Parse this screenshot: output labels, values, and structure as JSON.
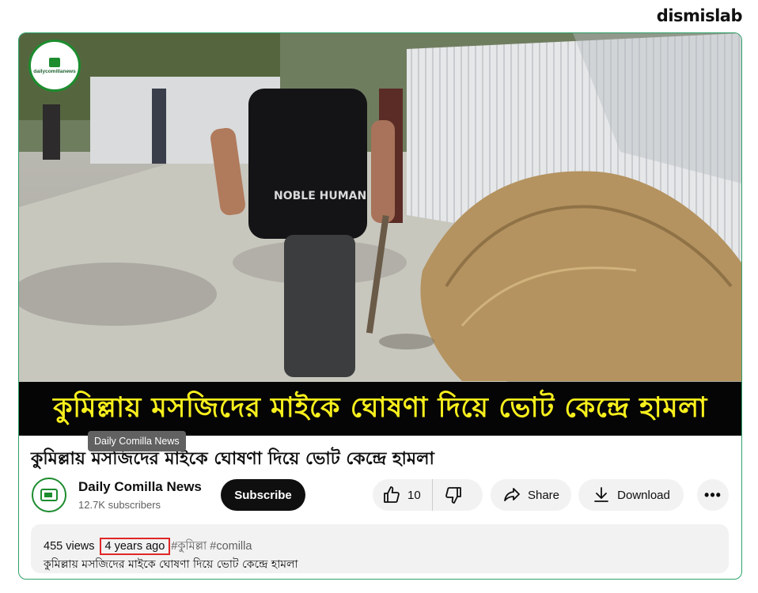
{
  "brand": "dismislab",
  "video": {
    "channel_logo_text": "dailycomillanews",
    "caption": "কুমিল্লায় মসজিদের মাইকে ঘোষণা দিয়ে ভোট কেন্দ্রে হামলা",
    "shirt_text": "NOBLE HUMAN"
  },
  "tooltip": "Daily Comilla News",
  "title": "কুমিল্লায় মসজিদের মাইকে ঘোষণা দিয়ে ভোট কেন্দ্রে হামলা",
  "owner": {
    "name": "Daily Comilla News",
    "subscribers": "12.7K subscribers"
  },
  "actions": {
    "subscribe": "Subscribe",
    "like_count": "10",
    "share": "Share",
    "download": "Download",
    "more": "•••"
  },
  "description": {
    "views": "455 views",
    "ago": "4 years ago",
    "tags": "#কুমিল্লা #comilla",
    "text": "কুমিল্লায় মসজিদের মাইকে ঘোষণা দিয়ে ভোট কেন্দ্রে হামলা"
  },
  "colors": {
    "frame_border": "#2fa26b",
    "caption_text": "#f7ef1c",
    "highlight_box": "#e02727"
  }
}
